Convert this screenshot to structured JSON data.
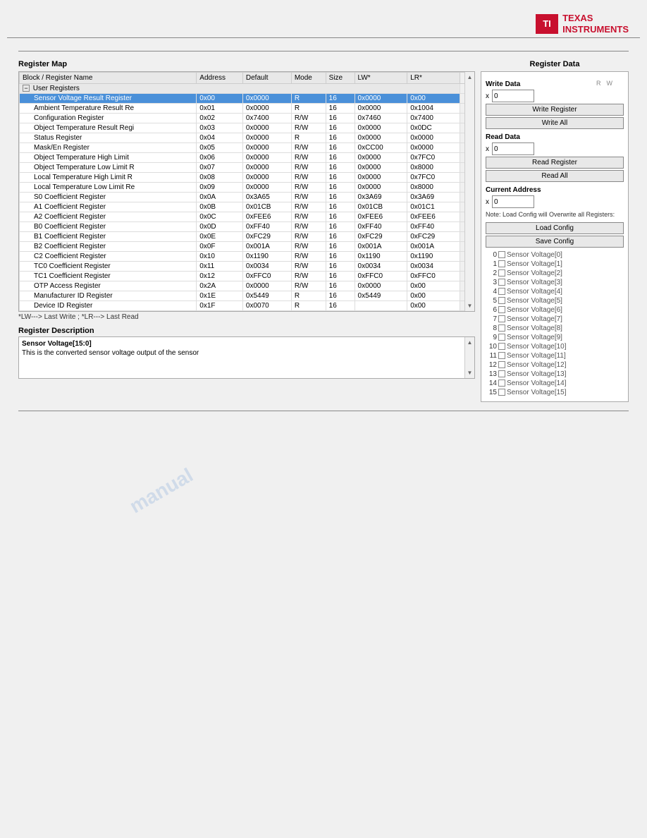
{
  "header": {
    "logo_line1": "TEXAS",
    "logo_line2": "INSTRUMENTS"
  },
  "register_map": {
    "title": "Register Map",
    "columns": [
      "Block / Register Name",
      "Address",
      "Default",
      "Mode",
      "Size",
      "LW*",
      "LR*"
    ],
    "group_label": "User Registers",
    "rows": [
      {
        "name": "Sensor Voltage Result Register",
        "address": "0x00",
        "default": "0x0000",
        "mode": "R",
        "size": "16",
        "lw": "0x0000",
        "lr": "0x00",
        "selected": true
      },
      {
        "name": "Ambient Temperature Result Re",
        "address": "0x01",
        "default": "0x0000",
        "mode": "R",
        "size": "16",
        "lw": "0x0000",
        "lr": "0x1004",
        "selected": false
      },
      {
        "name": "Configuration Register",
        "address": "0x02",
        "default": "0x7400",
        "mode": "R/W",
        "size": "16",
        "lw": "0x7460",
        "lr": "0x7400",
        "selected": false
      },
      {
        "name": "Object Temperature Result Regi",
        "address": "0x03",
        "default": "0x0000",
        "mode": "R/W",
        "size": "16",
        "lw": "0x0000",
        "lr": "0x0DC",
        "selected": false
      },
      {
        "name": "Status Register",
        "address": "0x04",
        "default": "0x0000",
        "mode": "R",
        "size": "16",
        "lw": "0x0000",
        "lr": "0x0000",
        "selected": false
      },
      {
        "name": "Mask/En Register",
        "address": "0x05",
        "default": "0x0000",
        "mode": "R/W",
        "size": "16",
        "lw": "0xCC00",
        "lr": "0x0000",
        "selected": false
      },
      {
        "name": "Object Temperature High Limit",
        "address": "0x06",
        "default": "0x0000",
        "mode": "R/W",
        "size": "16",
        "lw": "0x0000",
        "lr": "0x7FC0",
        "selected": false
      },
      {
        "name": "Object Temperature Low Limit R",
        "address": "0x07",
        "default": "0x0000",
        "mode": "R/W",
        "size": "16",
        "lw": "0x0000",
        "lr": "0x8000",
        "selected": false
      },
      {
        "name": "Local Temperature High Limit R",
        "address": "0x08",
        "default": "0x0000",
        "mode": "R/W",
        "size": "16",
        "lw": "0x0000",
        "lr": "0x7FC0",
        "selected": false
      },
      {
        "name": "Local Temperature Low Limit Re",
        "address": "0x09",
        "default": "0x0000",
        "mode": "R/W",
        "size": "16",
        "lw": "0x0000",
        "lr": "0x8000",
        "selected": false
      },
      {
        "name": "S0 Coefficient Register",
        "address": "0x0A",
        "default": "0x3A65",
        "mode": "R/W",
        "size": "16",
        "lw": "0x3A69",
        "lr": "0x3A69",
        "selected": false
      },
      {
        "name": "A1 Coefficient Register",
        "address": "0x0B",
        "default": "0x01CB",
        "mode": "R/W",
        "size": "16",
        "lw": "0x01CB",
        "lr": "0x01C1",
        "selected": false
      },
      {
        "name": "A2 Coefficient Register",
        "address": "0x0C",
        "default": "0xFEE6",
        "mode": "R/W",
        "size": "16",
        "lw": "0xFEE6",
        "lr": "0xFEE6",
        "selected": false
      },
      {
        "name": "B0 Coefficient Register",
        "address": "0x0D",
        "default": "0xFF40",
        "mode": "R/W",
        "size": "16",
        "lw": "0xFF40",
        "lr": "0xFF40",
        "selected": false
      },
      {
        "name": "B1 Coefficient Register",
        "address": "0x0E",
        "default": "0xFC29",
        "mode": "R/W",
        "size": "16",
        "lw": "0xFC29",
        "lr": "0xFC29",
        "selected": false
      },
      {
        "name": "B2 Coefficient Register",
        "address": "0x0F",
        "default": "0x001A",
        "mode": "R/W",
        "size": "16",
        "lw": "0x001A",
        "lr": "0x001A",
        "selected": false
      },
      {
        "name": "C2 Coefficient Register",
        "address": "0x10",
        "default": "0x1190",
        "mode": "R/W",
        "size": "16",
        "lw": "0x1190",
        "lr": "0x1190",
        "selected": false
      },
      {
        "name": "TC0 Coefficient Register",
        "address": "0x11",
        "default": "0x0034",
        "mode": "R/W",
        "size": "16",
        "lw": "0x0034",
        "lr": "0x0034",
        "selected": false
      },
      {
        "name": "TC1 Coefficient Register",
        "address": "0x12",
        "default": "0xFFC0",
        "mode": "R/W",
        "size": "16",
        "lw": "0xFFC0",
        "lr": "0xFFC0",
        "selected": false
      },
      {
        "name": "OTP Access Register",
        "address": "0x2A",
        "default": "0x0000",
        "mode": "R/W",
        "size": "16",
        "lw": "0x0000",
        "lr": "0x00",
        "selected": false
      },
      {
        "name": "Manufacturer ID Register",
        "address": "0x1E",
        "default": "0x5449",
        "mode": "R",
        "size": "16",
        "lw": "0x5449",
        "lr": "0x00",
        "selected": false
      },
      {
        "name": "Device ID Register",
        "address": "0x1F",
        "default": "0x0070",
        "mode": "R",
        "size": "16",
        "lw": "",
        "lr": "0x00",
        "selected": false
      }
    ],
    "footnote": "*LW---> Last Write ; *LR---> Last Read"
  },
  "register_data": {
    "title": "Register Data",
    "write_data_label": "Write Data",
    "r_label": "R",
    "w_label": "W",
    "write_data_value": "0",
    "write_data_prefix": "x",
    "write_register_btn": "Write Register",
    "write_all_btn": "Write All",
    "read_data_label": "Read Data",
    "read_data_value": "0",
    "read_data_prefix": "x",
    "read_register_btn": "Read Register",
    "read_all_btn": "Read All",
    "current_address_label": "Current Address",
    "current_address_prefix": "x",
    "current_address_value": "0",
    "note_text": "Note: Load Config will Overwrite all Registers:",
    "load_config_btn": "Load Config",
    "save_config_btn": "Save Config",
    "sensor_items": [
      {
        "num": "0",
        "label": "Sensor Voltage[0]"
      },
      {
        "num": "1",
        "label": "Sensor Voltage[1]"
      },
      {
        "num": "2",
        "label": "Sensor Voltage[2]"
      },
      {
        "num": "3",
        "label": "Sensor Voltage[3]"
      },
      {
        "num": "4",
        "label": "Sensor Voltage[4]"
      },
      {
        "num": "5",
        "label": "Sensor Voltage[5]"
      },
      {
        "num": "6",
        "label": "Sensor Voltage[6]"
      },
      {
        "num": "7",
        "label": "Sensor Voltage[7]"
      },
      {
        "num": "8",
        "label": "Sensor Voltage[8]"
      },
      {
        "num": "9",
        "label": "Sensor Voltage[9]"
      },
      {
        "num": "10",
        "label": "Sensor Voltage[10]"
      },
      {
        "num": "11",
        "label": "Sensor Voltage[11]"
      },
      {
        "num": "12",
        "label": "Sensor Voltage[12]"
      },
      {
        "num": "13",
        "label": "Sensor Voltage[13]"
      },
      {
        "num": "14",
        "label": "Sensor Voltage[14]"
      },
      {
        "num": "15",
        "label": "Sensor Voltage[15]"
      }
    ]
  },
  "register_description": {
    "title": "Register Description",
    "name": "Sensor Voltage[15:0]",
    "description": "This is the converted sensor voltage output of the sensor"
  },
  "watermark": "manual"
}
